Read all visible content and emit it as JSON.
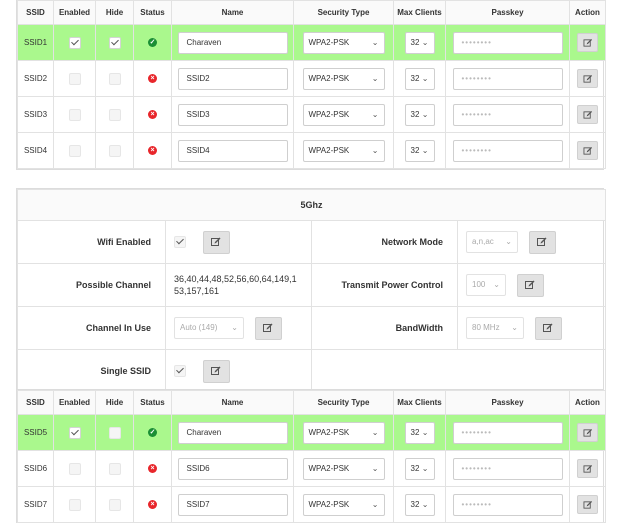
{
  "headers": {
    "ssid": "SSID",
    "enabled": "Enabled",
    "hide": "Hide",
    "status": "Status",
    "name": "Name",
    "security": "Security Type",
    "max_clients": "Max Clients",
    "passkey": "Passkey",
    "action": "Action"
  },
  "table1": [
    {
      "ssid": "SSID1",
      "name": "Charaven",
      "security": "WPA2-PSK",
      "max": "32",
      "passkey": "••••••••",
      "enabled": true,
      "hide": true,
      "status": "ok"
    },
    {
      "ssid": "SSID2",
      "name": "SSID2",
      "security": "WPA2-PSK",
      "max": "32",
      "passkey": "••••••••",
      "enabled": false,
      "hide": false,
      "status": "error"
    },
    {
      "ssid": "SSID3",
      "name": "SSID3",
      "security": "WPA2-PSK",
      "max": "32",
      "passkey": "••••••••",
      "enabled": false,
      "hide": false,
      "status": "error"
    },
    {
      "ssid": "SSID4",
      "name": "SSID4",
      "security": "WPA2-PSK",
      "max": "32",
      "passkey": "••••••••",
      "enabled": false,
      "hide": false,
      "status": "error"
    }
  ],
  "band5": {
    "title": "5Ghz",
    "wifi_enabled_label": "Wifi Enabled",
    "network_mode_label": "Network Mode",
    "network_mode_value": "a,n,ac",
    "possible_channel_label": "Possible Channel",
    "possible_channel_value": "36,40,44,48,52,56,60,64,149,153,157,161",
    "tx_power_label": "Transmit Power Control",
    "tx_power_value": "100",
    "channel_in_use_label": "Channel In Use",
    "channel_in_use_value": "Auto (149)",
    "bandwidth_label": "BandWidth",
    "bandwidth_value": "80 MHz",
    "single_ssid_label": "Single SSID"
  },
  "table2": [
    {
      "ssid": "SSID5",
      "name": "Charaven",
      "security": "WPA2-PSK",
      "max": "32",
      "passkey": "••••••••",
      "enabled": true,
      "hide": false,
      "status": "ok"
    },
    {
      "ssid": "SSID6",
      "name": "SSID6",
      "security": "WPA2-PSK",
      "max": "32",
      "passkey": "••••••••",
      "enabled": false,
      "hide": false,
      "status": "error"
    },
    {
      "ssid": "SSID7",
      "name": "SSID7",
      "security": "WPA2-PSK",
      "max": "32",
      "passkey": "••••••••",
      "enabled": false,
      "hide": false,
      "status": "error"
    }
  ],
  "icons": {
    "check": "check-icon",
    "status_ok": "check-circle-icon",
    "status_error": "x-circle-icon",
    "edit": "edit-icon",
    "dropdown": "chevron-down-icon"
  },
  "colors": {
    "active_row": "#aaf88d",
    "status_ok": "#1b8f35",
    "status_error": "#e8262b"
  }
}
